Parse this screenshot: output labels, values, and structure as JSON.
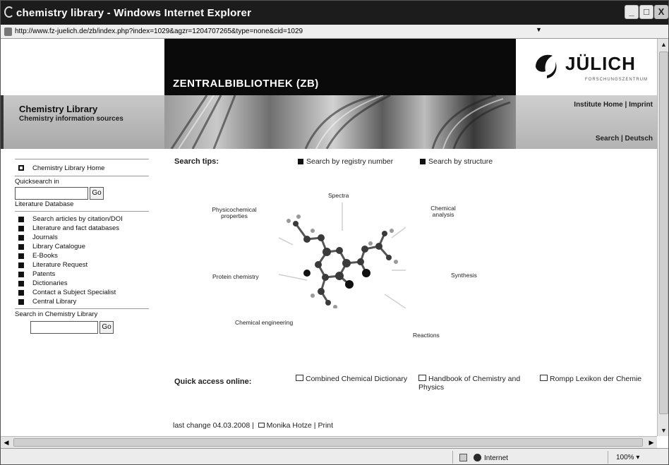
{
  "window": {
    "title": "chemistry library - Windows Internet Explorer",
    "minimize": "_",
    "maximize": "□",
    "close": "X"
  },
  "address": {
    "url": "http://www.fz-juelich.de/zb/index.php?index=1029&agzr=1204707265&type=none&cid=1029",
    "dropdown": "▼"
  },
  "header": {
    "zb_title": "ZENTRALBIBLIOTHEK (ZB)",
    "logo_name": "JÜLICH",
    "logo_sub": "FORSCHUNGSZENTRUM"
  },
  "banner": {
    "title": "Chemistry Library",
    "subtitle": "Chemistry information sources",
    "institute_home": "Institute Home",
    "imprint": "Imprint",
    "search": "Search",
    "deutsch": "Deutsch",
    "sep": " | "
  },
  "sidebar": {
    "home": "Chemistry Library Home",
    "quicksearch_label": "Quicksearch in",
    "go": "Go",
    "quicksearch_db": "Literature Database",
    "items": [
      "Search articles by citation/DOI",
      "Literature and fact databases",
      "Journals",
      "Library Catalogue",
      "E-Books",
      "Literature Request",
      "Patents",
      "Dictionaries",
      "Contact a Subject Specialist",
      "Central Library"
    ],
    "search_label": "Search in Chemistry Library"
  },
  "main": {
    "search_tips": "Search tips:",
    "tip1": "Search by registry number",
    "tip2": "Search by structure",
    "diagram_labels": {
      "spectra": "Spectra",
      "physico": "Physicochemical properties",
      "chem_analysis": "Chemical analysis",
      "protein": "Protein chemistry",
      "synthesis": "Synthesis",
      "chem_eng": "Chemical engineering",
      "reactions": "Reactions"
    },
    "quick_access": "Quick access online:",
    "qa1": "Combined Chemical Dictionary",
    "qa2": "Handbook of Chemistry and Physics",
    "qa3": "Rompp Lexikon der Chemie"
  },
  "footer": {
    "last_change": "last change 04.03.2008 |",
    "author": "Monika Hotze",
    "print": "Print",
    "sep": " | "
  },
  "scroll": {
    "up": "▲",
    "down": "▼",
    "left": "◀",
    "right": "▶"
  },
  "status": {
    "zone": "Internet",
    "zoom": "100%",
    "zoom_arrow": "▾"
  }
}
